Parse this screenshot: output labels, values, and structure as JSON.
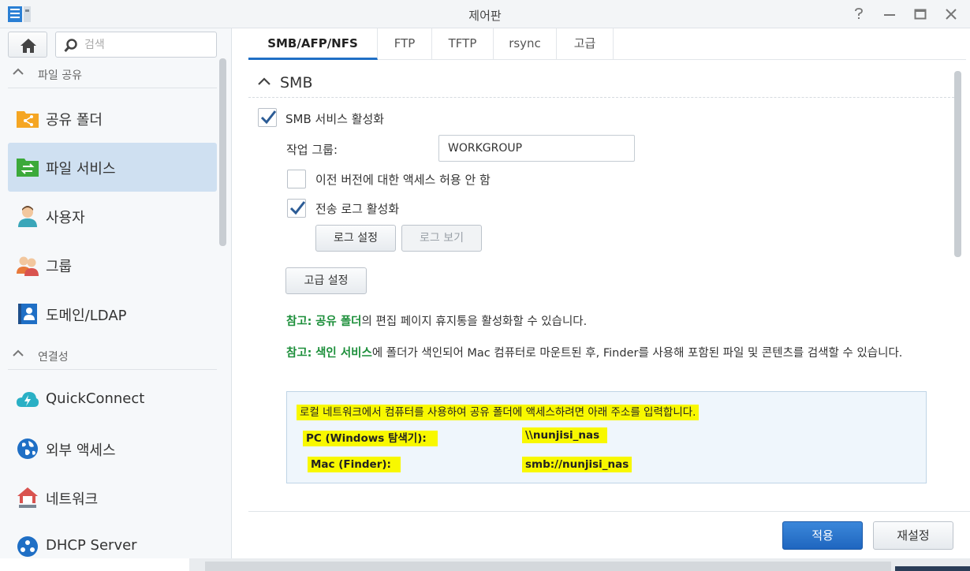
{
  "window": {
    "title": "제어판",
    "help_glyph": "?",
    "min_glyph": "—",
    "max_glyph": "☐",
    "close_glyph": "✕"
  },
  "sidebar": {
    "search_placeholder": "검색",
    "sections": [
      {
        "label": "파일 공유"
      },
      {
        "label": "연결성"
      }
    ],
    "items": [
      {
        "label": "공유 폴더",
        "icon": "shared-folder-icon",
        "color": "#f5a623"
      },
      {
        "label": "파일 서비스",
        "icon": "file-services-icon",
        "color": "#3ca93a",
        "active": true
      },
      {
        "label": "사용자",
        "icon": "user-icon",
        "color": "#3aa6b9"
      },
      {
        "label": "그룹",
        "icon": "group-icon",
        "color": "#e8793a"
      },
      {
        "label": "도메인/LDAP",
        "icon": "domain-ldap-icon",
        "color": "#1f6fc5"
      },
      {
        "label": "QuickConnect",
        "icon": "quickconnect-icon",
        "color": "#2ab0c5"
      },
      {
        "label": "외부 액세스",
        "icon": "external-access-icon",
        "color": "#1f6fc5"
      },
      {
        "label": "네트워크",
        "icon": "network-icon",
        "color": "#d9534f"
      },
      {
        "label": "DHCP Server",
        "icon": "dhcp-server-icon",
        "color": "#1f6fc5"
      }
    ]
  },
  "tabs": [
    {
      "label": "SMB/AFP/NFS",
      "active": true
    },
    {
      "label": "FTP"
    },
    {
      "label": "TFTP"
    },
    {
      "label": "rsync"
    },
    {
      "label": "고급"
    }
  ],
  "smb": {
    "section_title": "SMB",
    "enable_label": "SMB 서비스 활성화",
    "enable_checked": true,
    "workgroup_label": "작업 그룹:",
    "workgroup_value": "WORKGROUP",
    "prev_version_label": "이전 버전에 대한 액세스 허용 안 함",
    "prev_version_checked": false,
    "transfer_log_label": "전송 로그 활성화",
    "transfer_log_checked": true,
    "log_settings_btn": "로그 설정",
    "log_view_btn": "로그 보기",
    "advanced_btn": "고급 설정",
    "note1": {
      "prefix": "참고:",
      "key": "공유 폴더",
      "rest": "의 편집 페이지 휴지통을 활성화할 수 있습니다."
    },
    "note2": {
      "prefix": "참고:",
      "key": "색인 서비스",
      "rest": "에 폴더가 색인되어 Mac 컴퓨터로 마운트된 후, Finder를 사용해 포함된 파일 및 콘텐츠를 검색할 수 있습니다."
    },
    "info": {
      "intro": "로컬 네트워크에서 컴퓨터를 사용하여 공유 폴더에 액세스하려면 아래 주소를 입력합니다.",
      "pc_label": "PC (Windows 탐색기):",
      "pc_value": "\\\\nunjisi_nas",
      "mac_label": "Mac (Finder):",
      "mac_value": "smb://nunjisi_nas"
    }
  },
  "footer": {
    "apply": "적용",
    "reset": "재설정"
  },
  "colors": {
    "accent": "#1f6fc5",
    "note_key": "#1d8f3b",
    "highlight": "#f8f800"
  }
}
